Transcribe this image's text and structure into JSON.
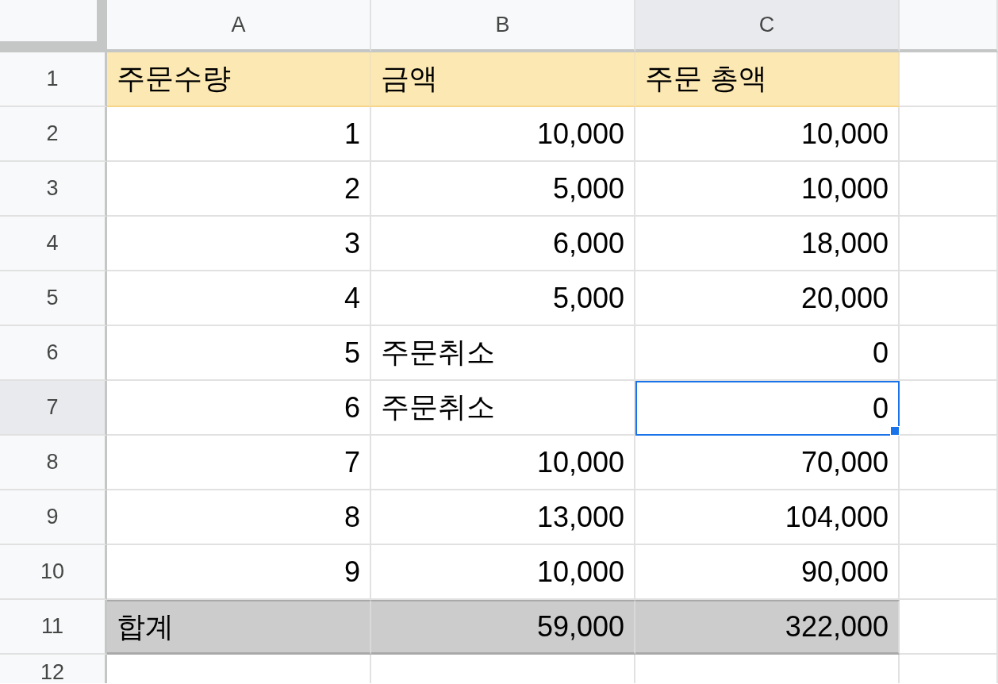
{
  "columns": [
    {
      "label": "A",
      "selected": false
    },
    {
      "label": "B",
      "selected": false
    },
    {
      "label": "C",
      "selected": true
    }
  ],
  "rows": [
    {
      "number": "1",
      "kind": "header",
      "selected": false,
      "cells": [
        {
          "text": "주문수량",
          "kind": "text"
        },
        {
          "text": "금액",
          "kind": "text"
        },
        {
          "text": "주문 총액",
          "kind": "text"
        }
      ]
    },
    {
      "number": "2",
      "kind": "data",
      "selected": false,
      "cells": [
        {
          "text": "1",
          "kind": "number"
        },
        {
          "text": "10,000",
          "kind": "number"
        },
        {
          "text": "10,000",
          "kind": "number"
        }
      ]
    },
    {
      "number": "3",
      "kind": "data",
      "selected": false,
      "cells": [
        {
          "text": "2",
          "kind": "number"
        },
        {
          "text": "5,000",
          "kind": "number"
        },
        {
          "text": "10,000",
          "kind": "number"
        }
      ]
    },
    {
      "number": "4",
      "kind": "data",
      "selected": false,
      "cells": [
        {
          "text": "3",
          "kind": "number"
        },
        {
          "text": "6,000",
          "kind": "number"
        },
        {
          "text": "18,000",
          "kind": "number"
        }
      ]
    },
    {
      "number": "5",
      "kind": "data",
      "selected": false,
      "cells": [
        {
          "text": "4",
          "kind": "number"
        },
        {
          "text": "5,000",
          "kind": "number"
        },
        {
          "text": "20,000",
          "kind": "number"
        }
      ]
    },
    {
      "number": "6",
      "kind": "data",
      "selected": false,
      "cells": [
        {
          "text": "5",
          "kind": "number"
        },
        {
          "text": "주문취소",
          "kind": "text"
        },
        {
          "text": "0",
          "kind": "number"
        }
      ]
    },
    {
      "number": "7",
      "kind": "data",
      "selected": true,
      "cells": [
        {
          "text": "6",
          "kind": "number"
        },
        {
          "text": "주문취소",
          "kind": "text"
        },
        {
          "text": "0",
          "kind": "number"
        }
      ]
    },
    {
      "number": "8",
      "kind": "data",
      "selected": false,
      "cells": [
        {
          "text": "7",
          "kind": "number"
        },
        {
          "text": "10,000",
          "kind": "number"
        },
        {
          "text": "70,000",
          "kind": "number"
        }
      ]
    },
    {
      "number": "9",
      "kind": "data",
      "selected": false,
      "cells": [
        {
          "text": "8",
          "kind": "number"
        },
        {
          "text": "13,000",
          "kind": "number"
        },
        {
          "text": "104,000",
          "kind": "number"
        }
      ]
    },
    {
      "number": "10",
      "kind": "data",
      "selected": false,
      "cells": [
        {
          "text": "9",
          "kind": "number"
        },
        {
          "text": "10,000",
          "kind": "number"
        },
        {
          "text": "90,000",
          "kind": "number"
        }
      ]
    },
    {
      "number": "11",
      "kind": "total",
      "selected": false,
      "cells": [
        {
          "text": "합계",
          "kind": "text"
        },
        {
          "text": "59,000",
          "kind": "number"
        },
        {
          "text": "322,000",
          "kind": "number"
        }
      ]
    },
    {
      "number": "12",
      "kind": "blank",
      "selected": false
    }
  ]
}
